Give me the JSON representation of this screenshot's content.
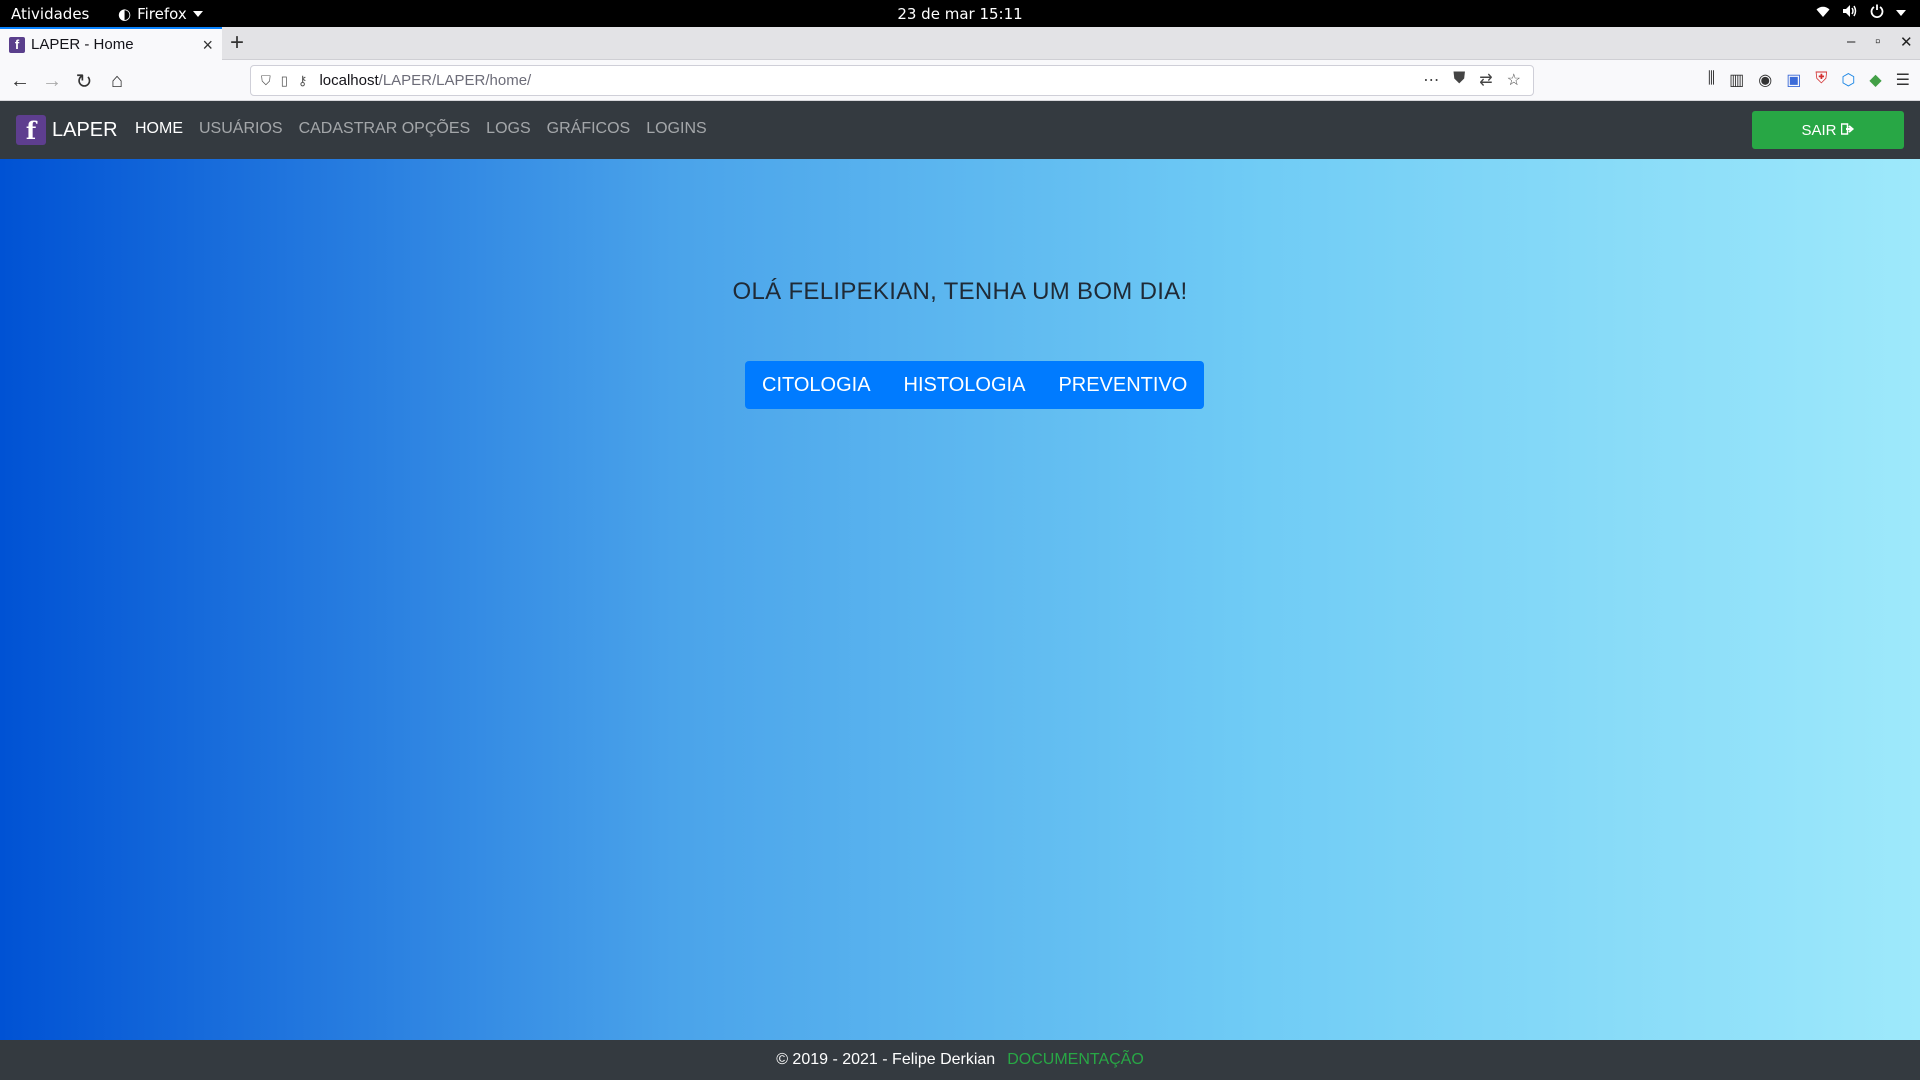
{
  "system_bar": {
    "activities": "Atividades",
    "app_name": "Firefox",
    "clock": "23 de mar  15:11"
  },
  "browser": {
    "tab_title": "LAPER - Home",
    "url_host": "localhost",
    "url_path": "/LAPER/LAPER/home/"
  },
  "app": {
    "brand_logo": "f",
    "brand_name": "LAPER",
    "menu": {
      "home": "HOME",
      "usuarios": "USUÁRIOS",
      "cadastrar": "CADASTRAR OPÇÕES",
      "logs": "LOGS",
      "graficos": "GRÁFICOS",
      "logins": "LOGINS"
    },
    "logout_label": "SAIR"
  },
  "hero": {
    "greeting": "OLÁ FELIPEKIAN, TENHA UM BOM DIA!",
    "buttons": {
      "citologia": "CITOLOGIA",
      "histologia": "HISTOLOGIA",
      "preventivo": "PREVENTIVO"
    },
    "gradient": [
      "#0052d4",
      "#4aa3ea",
      "#6fcbf5",
      "#9ee9fb"
    ]
  },
  "footer": {
    "copyright": "© 2019 - 2021 - Felipe Derkian",
    "doc_link": "DOCUMENTAÇÃO"
  },
  "colors": {
    "navbar": "#343a40",
    "primary": "#007bff",
    "success": "#28a745"
  }
}
